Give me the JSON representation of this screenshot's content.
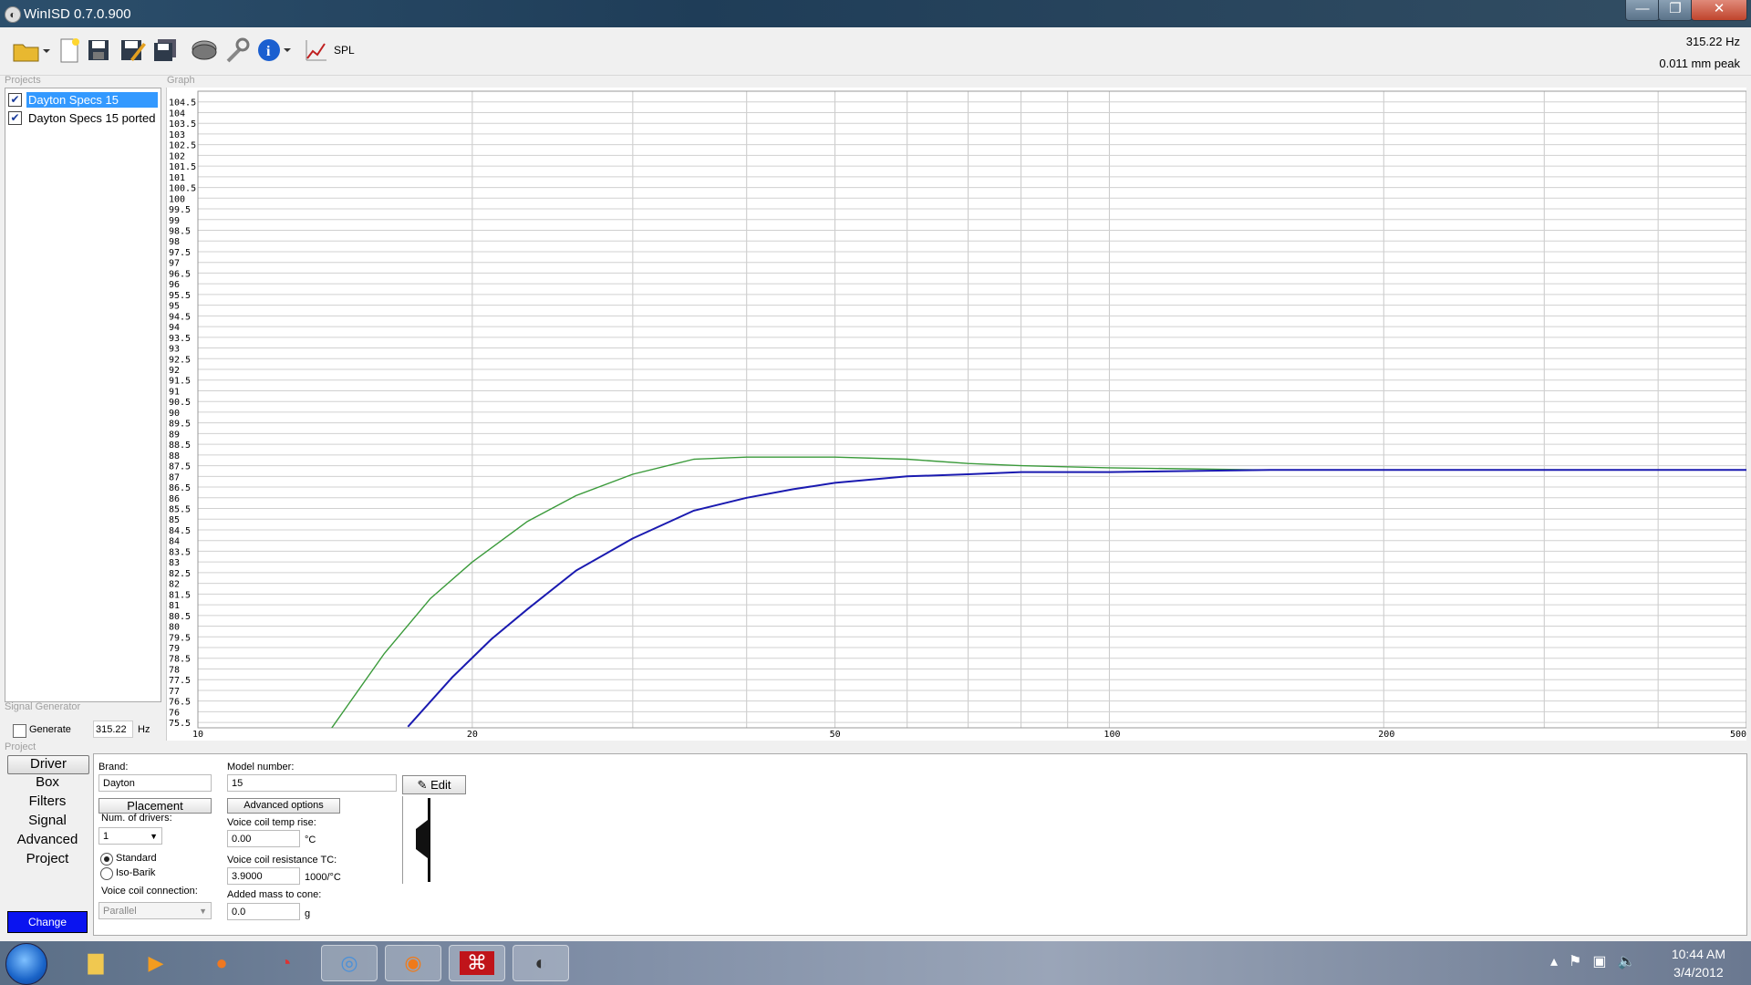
{
  "window": {
    "title": "WinISD 0.7.0.900"
  },
  "caption_buttons": {
    "minimize": "—",
    "maximize": "❐",
    "close": "✕"
  },
  "toolbar": {
    "spl_label": "SPL",
    "readout_freq": "315.22 Hz",
    "readout_excursion": "0.011 mm peak"
  },
  "sections": {
    "projects": "Projects",
    "graph": "Graph",
    "signal_generator": "Signal Generator",
    "project": "Project"
  },
  "projects": [
    {
      "name": "Dayton Specs 15",
      "checked": true,
      "selected": true
    },
    {
      "name": "Dayton Specs 15 ported",
      "checked": true,
      "selected": false
    }
  ],
  "signal_generator": {
    "generate_label": "Generate",
    "frequency": "315.22",
    "unit": "Hz"
  },
  "nav": {
    "items": [
      "Driver",
      "Box",
      "Filters",
      "Signal",
      "Advanced",
      "Project"
    ],
    "active": "Driver",
    "change_label": "Change"
  },
  "driver": {
    "brand_label": "Brand:",
    "brand": "Dayton",
    "model_label": "Model number:",
    "model": "15",
    "edit_label": "Edit",
    "placement_label": "Placement",
    "advanced_label": "Advanced options",
    "num_drivers_label": "Num. of drivers:",
    "num_drivers": "1",
    "standard_label": "Standard",
    "isobarik_label": "Iso-Barik",
    "coil_connection_label": "Voice coil connection:",
    "coil_connection": "Parallel",
    "temp_rise_label": "Voice coil temp rise:",
    "temp_rise": "0.00",
    "temp_unit": "°C",
    "resistance_tc_label": "Voice coil resistance TC:",
    "resistance_tc": "3.9000",
    "tc_unit": "1000/°C",
    "added_mass_label": "Added mass to cone:",
    "added_mass": "0.0",
    "mass_unit": "g"
  },
  "chart_data": {
    "type": "line",
    "xscale": "log",
    "xlim": [
      10,
      500
    ],
    "ylim": [
      75.25,
      105
    ],
    "xticks": [
      10,
      20,
      50,
      100,
      200,
      500
    ],
    "yticks": [
      "104.5",
      "104",
      "103.5",
      "103",
      "102.5",
      "102",
      "101.5",
      "101",
      "100.5",
      "100",
      "99.5",
      "99",
      "98.5",
      "98",
      "97.5",
      "97",
      "96.5",
      "96",
      "95.5",
      "95",
      "94.5",
      "94",
      "93.5",
      "93",
      "92.5",
      "92",
      "91.5",
      "91",
      "90.5",
      "90",
      "89.5",
      "89",
      "88.5",
      "88",
      "87.5",
      "87",
      "86.5",
      "86",
      "85.5",
      "85",
      "84.5",
      "84",
      "83.5",
      "83",
      "82.5",
      "82",
      "81.5",
      "81",
      "80.5",
      "80",
      "79.5",
      "79",
      "78.5",
      "78",
      "77.5",
      "77",
      "76.5",
      "76",
      "75.5"
    ],
    "grid": true,
    "series": [
      {
        "color": "#3a9a3a",
        "x": [
          14,
          16,
          18,
          20,
          23,
          26,
          30,
          35,
          40,
          50,
          60,
          70,
          80,
          100,
          150,
          200,
          300,
          500
        ],
        "y": [
          75.2,
          78.7,
          81.3,
          83.0,
          84.9,
          86.1,
          87.1,
          87.8,
          87.9,
          87.9,
          87.8,
          87.6,
          87.5,
          87.4,
          87.3,
          87.3,
          87.3,
          87.3
        ]
      },
      {
        "color": "#1a1ab0",
        "x": [
          17,
          19,
          21,
          23,
          26,
          30,
          35,
          40,
          45,
          50,
          60,
          70,
          80,
          100,
          150,
          200,
          300,
          500
        ],
        "y": [
          75.3,
          77.6,
          79.4,
          80.8,
          82.6,
          84.1,
          85.4,
          86.0,
          86.4,
          86.7,
          87.0,
          87.1,
          87.2,
          87.2,
          87.3,
          87.3,
          87.3,
          87.3
        ]
      }
    ]
  },
  "taskbar": {
    "apps": [
      "explorer-app",
      "media-player-app",
      "media-center-app",
      "speed-gauge-app",
      "messenger-app",
      "firefox-app",
      "acrobat-app",
      "winisd-app"
    ],
    "time": "10:44 AM",
    "date": "3/4/2012"
  }
}
